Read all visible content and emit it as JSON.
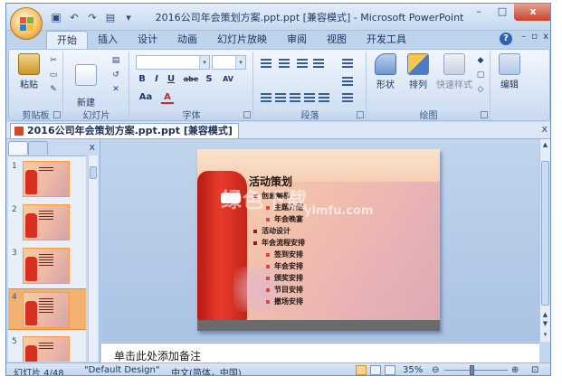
{
  "window": {
    "title": "2016公司年会策划方案.ppt.ppt [兼容模式] - Microsoft PowerPoint",
    "controls": [
      "–",
      "□",
      "x"
    ]
  },
  "quick_access": [
    "save",
    "undo",
    "redo",
    "print",
    "customize"
  ],
  "tabs": [
    "开始",
    "插入",
    "设计",
    "动画",
    "幻灯片放映",
    "审阅",
    "视图",
    "开发工具"
  ],
  "active_tab": "开始",
  "ribbon": {
    "groups": [
      {
        "label": "剪贴板",
        "buttons": [
          "粘贴"
        ]
      },
      {
        "label": "幻灯片",
        "buttons": [
          "新建\n幻灯片"
        ]
      },
      {
        "label": "字体",
        "buttons": [
          "B",
          "I",
          "U",
          "abe",
          "S",
          "AV",
          "Aa",
          "A"
        ]
      },
      {
        "label": "段落",
        "buttons": []
      },
      {
        "label": "绘图",
        "buttons": [
          "形状",
          "排列",
          "快速样式"
        ]
      },
      {
        "label": "",
        "buttons": [
          "编辑"
        ]
      }
    ]
  },
  "doc_tab": {
    "name": "2016公司年会策划方案.ppt.ppt [兼容模式]"
  },
  "slides_pane": {
    "thumbnails": [
      {
        "num": "1",
        "selected": false
      },
      {
        "num": "2",
        "selected": false
      },
      {
        "num": "3",
        "selected": false
      },
      {
        "num": "4",
        "selected": true
      },
      {
        "num": "5",
        "selected": false
      }
    ]
  },
  "slide": {
    "title": "活动策划",
    "bullets": [
      {
        "text": "创意解析",
        "level": 1
      },
      {
        "text": "主题介绍",
        "level": 2
      },
      {
        "text": "年会晚宴",
        "level": 2
      },
      {
        "text": "活动设计",
        "level": 1
      },
      {
        "text": "年会流程安排",
        "level": 1
      },
      {
        "text": "签到安排",
        "level": 2
      },
      {
        "text": "年会安排",
        "level": 2
      },
      {
        "text": "颁奖安排",
        "level": 2
      },
      {
        "text": "节目安排",
        "level": 2
      },
      {
        "text": "撤场安排",
        "level": 2
      }
    ],
    "watermark": "绿色下载",
    "watermark_url": "ylmfu.com"
  },
  "notes": {
    "placeholder": "单击此处添加备注"
  },
  "status": {
    "slide_info": "幻灯片 4/48",
    "theme": "\"Default Design\"",
    "language": "中文(简体，中国)",
    "zoom": "35%",
    "zoom_value": 0.35
  },
  "colors": {
    "accent": "#c4d7ee",
    "selected_thumb": "#f3b171",
    "slide_coat": "#d72f21"
  }
}
